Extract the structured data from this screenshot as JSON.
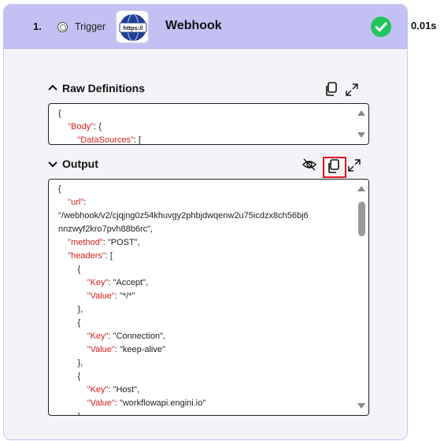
{
  "step": {
    "number": "1.",
    "type_label": "Trigger",
    "app_name": "Webhook",
    "logo_text": "https://",
    "duration": "0.01s",
    "status_icon": "check-circle-icon",
    "status_color": "#22c55e"
  },
  "colors": {
    "header_bg": "#c3c0f3",
    "json_key": "#d62020",
    "highlight": "#e0141e"
  },
  "raw_definitions": {
    "title": "Raw Definitions",
    "lines": [
      {
        "indent": "",
        "key": "",
        "value": "{"
      },
      {
        "indent": "    ",
        "key": "\"Body\"",
        "value": ": {"
      },
      {
        "indent": "        ",
        "key": "\"DataSources\"",
        "value": ": ["
      }
    ]
  },
  "output": {
    "title": "Output",
    "lines": [
      {
        "indent": "",
        "key": "",
        "value": "{"
      },
      {
        "indent": "    ",
        "key": "\"url\"",
        "value": ":"
      },
      {
        "indent": "",
        "key": "",
        "value": "\"/webhook/v2/cjqjng0z54khuvgy2phbjdwqenw2u75icdzx8ch56bj6"
      },
      {
        "indent": "",
        "key": "",
        "value": "nnzwyf2kro7pvh88b6rc\","
      },
      {
        "indent": "    ",
        "key": "\"method\"",
        "value": ": \"POST\","
      },
      {
        "indent": "    ",
        "key": "\"headers\"",
        "value": ": ["
      },
      {
        "indent": "        ",
        "key": "",
        "value": "{"
      },
      {
        "indent": "            ",
        "key": "\"Key\"",
        "value": ": \"Accept\","
      },
      {
        "indent": "            ",
        "key": "\"Value\"",
        "value": ": \"*/*\""
      },
      {
        "indent": "        ",
        "key": "",
        "value": "},"
      },
      {
        "indent": "        ",
        "key": "",
        "value": "{"
      },
      {
        "indent": "            ",
        "key": "\"Key\"",
        "value": ": \"Connection\","
      },
      {
        "indent": "            ",
        "key": "\"Value\"",
        "value": ": \"keep-alive\""
      },
      {
        "indent": "        ",
        "key": "",
        "value": "},"
      },
      {
        "indent": "        ",
        "key": "",
        "value": "{"
      },
      {
        "indent": "            ",
        "key": "\"Key\"",
        "value": ": \"Host\","
      },
      {
        "indent": "            ",
        "key": "\"Value\"",
        "value": ": \"workflowapi.engini.io\""
      },
      {
        "indent": "        ",
        "key": "",
        "value": "},"
      }
    ]
  },
  "icons": {
    "collapse": "chevron-up-icon",
    "expand": "chevron-down-icon",
    "copy": "copy-icon",
    "popout": "expand-arrows-icon",
    "hide": "eye-off-icon"
  }
}
